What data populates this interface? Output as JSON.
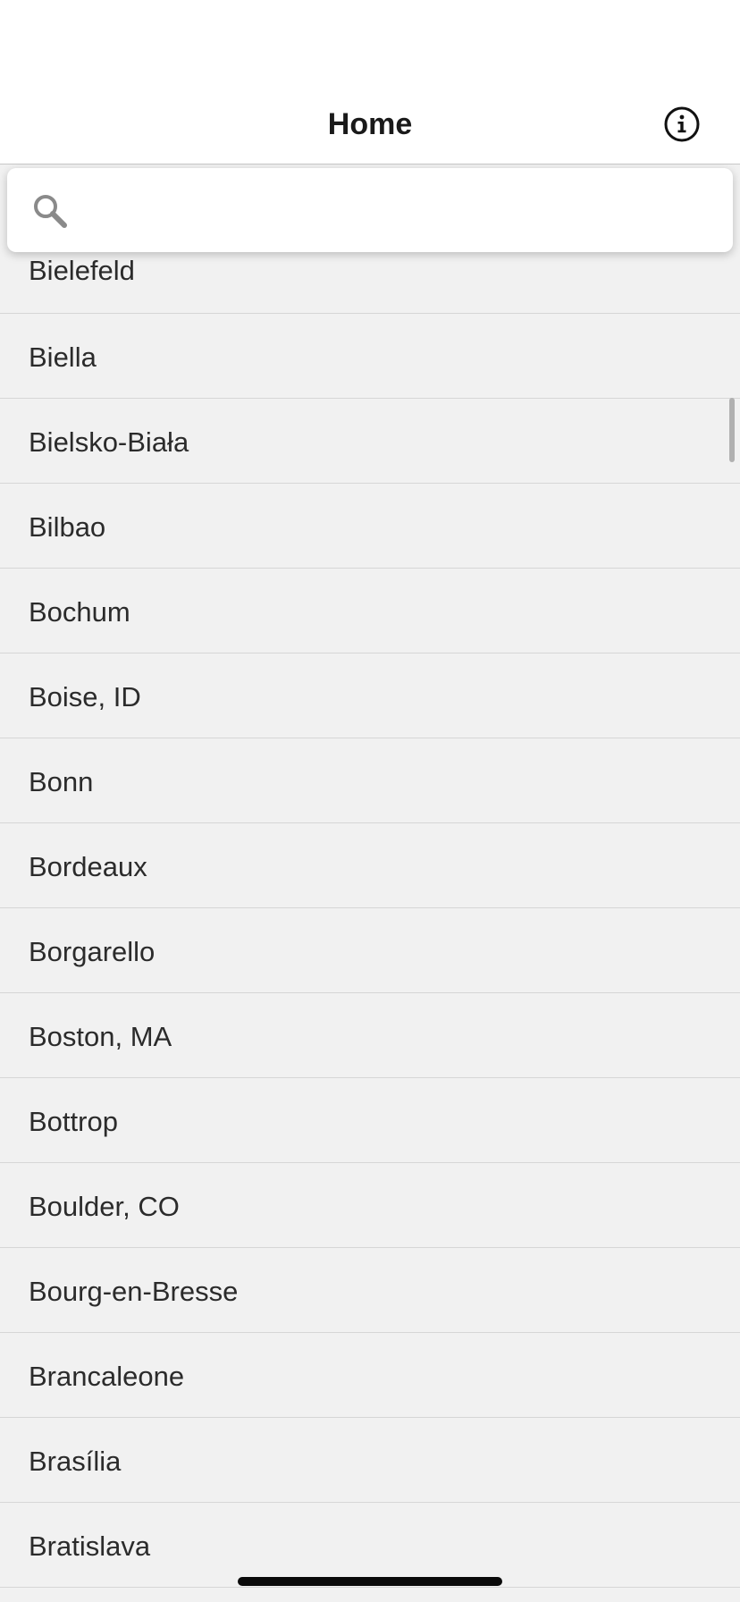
{
  "nav": {
    "title": "Home",
    "info_icon": "info-circle-icon"
  },
  "search": {
    "icon": "search-icon",
    "value": "",
    "placeholder": ""
  },
  "cities": [
    "Bielefeld",
    "Biella",
    "Bielsko-Biała",
    "Bilbao",
    "Bochum",
    "Boise, ID",
    "Bonn",
    "Bordeaux",
    "Borgarello",
    "Boston, MA",
    "Bottrop",
    "Boulder, CO",
    "Bourg-en-Bresse",
    "Brancaleone",
    "Brasília",
    "Bratislava"
  ],
  "colors": {
    "background": "#f1f1f1",
    "bar": "#ffffff",
    "text": "#2b2b2b",
    "divider": "#d6d6d6"
  }
}
